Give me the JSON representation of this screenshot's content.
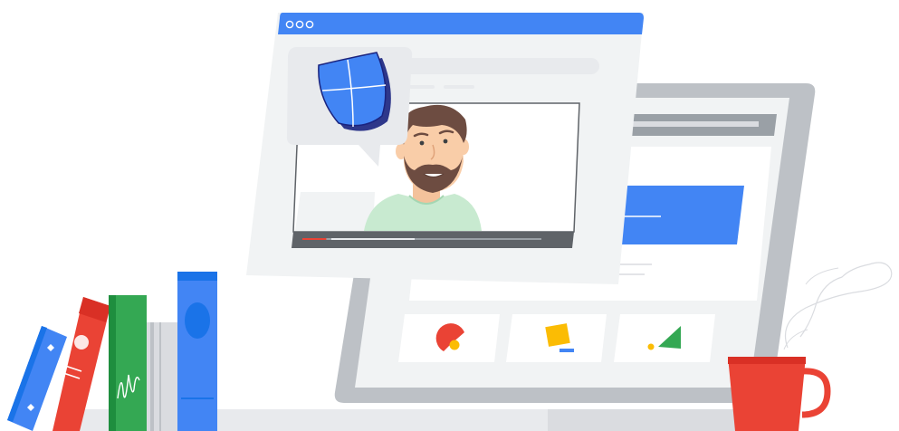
{
  "illustration": {
    "subject": "online-security-training",
    "colors": {
      "google_blue": "#4285f4",
      "google_red": "#ea4335",
      "google_yellow": "#fbbc04",
      "google_green": "#34a853",
      "window_gray": "#f1f3f4",
      "frame_gray": "#bdc1c6",
      "dark_bar": "#5f6368",
      "hair_brown": "#6d4c41",
      "skin": "#f9cda8",
      "shirt_mint": "#c8ead0"
    },
    "icons": [
      "shield-icon",
      "window-controls",
      "video-progress-bar",
      "pie-shape-icon",
      "square-shape-icon",
      "triangle-shape-icon",
      "coffee-mug",
      "steam",
      "books"
    ],
    "video": {
      "progress": 0.1
    }
  }
}
